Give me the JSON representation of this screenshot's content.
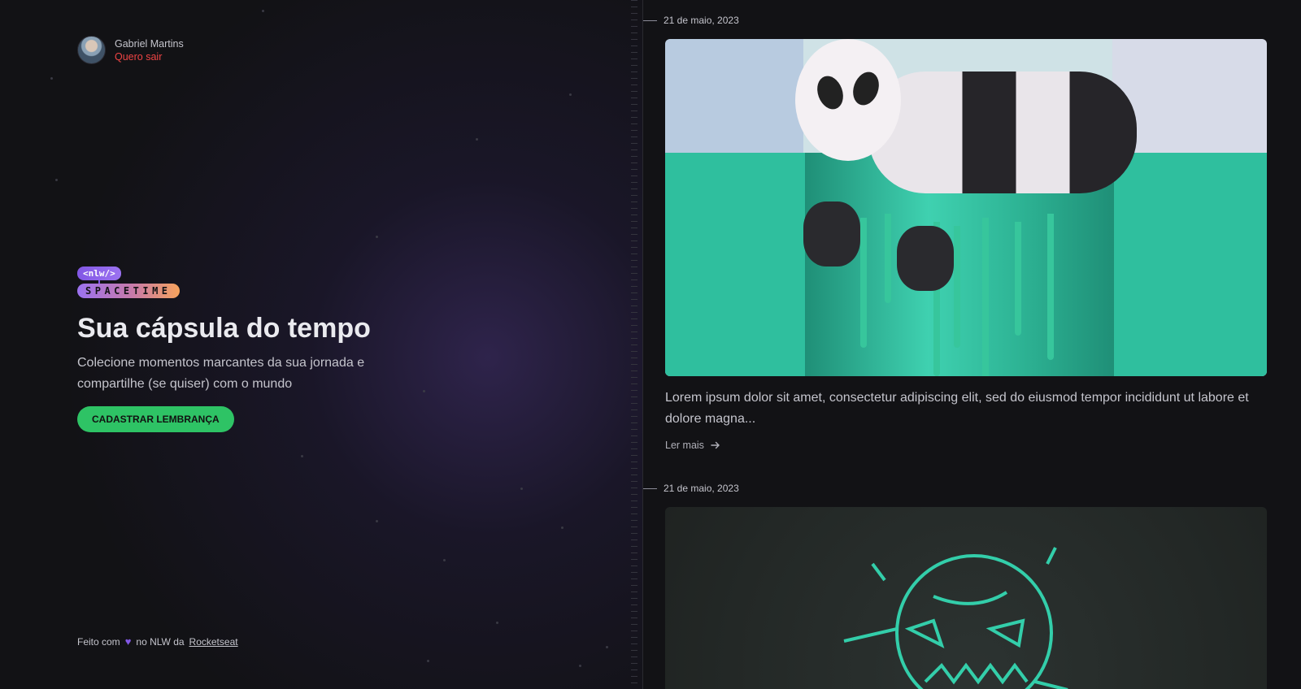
{
  "user": {
    "name": "Gabriel Martins",
    "logout_label": "Quero sair"
  },
  "brand": {
    "tag": "<nlw/>",
    "name": "SPACETIME"
  },
  "hero": {
    "title": "Sua cápsula do tempo",
    "subtitle": "Colecione momentos marcantes da sua jornada e compartilhe (se quiser) com o mundo",
    "cta_label": "CADASTRAR LEMBRANÇA"
  },
  "footer": {
    "prefix": "Feito com",
    "suffix": "no NLW da",
    "link": "Rocketseat"
  },
  "memories": [
    {
      "date": "21 de maio, 2023",
      "image": "panda-cake-image",
      "excerpt": "Lorem ipsum dolor sit amet, consectetur adipiscing elit, sed do eiusmod tempor incididunt ut labore et dolore magna...",
      "read_more": "Ler mais"
    },
    {
      "date": "21 de maio, 2023",
      "image": "neon-monster-image"
    }
  ],
  "colors": {
    "background": "#121215",
    "accent_purple": "#8257e5",
    "accent_green": "#2ec365",
    "logout_red": "#ef4444"
  },
  "icons": {
    "heart": "heart-icon",
    "arrow": "arrow-right-icon"
  }
}
